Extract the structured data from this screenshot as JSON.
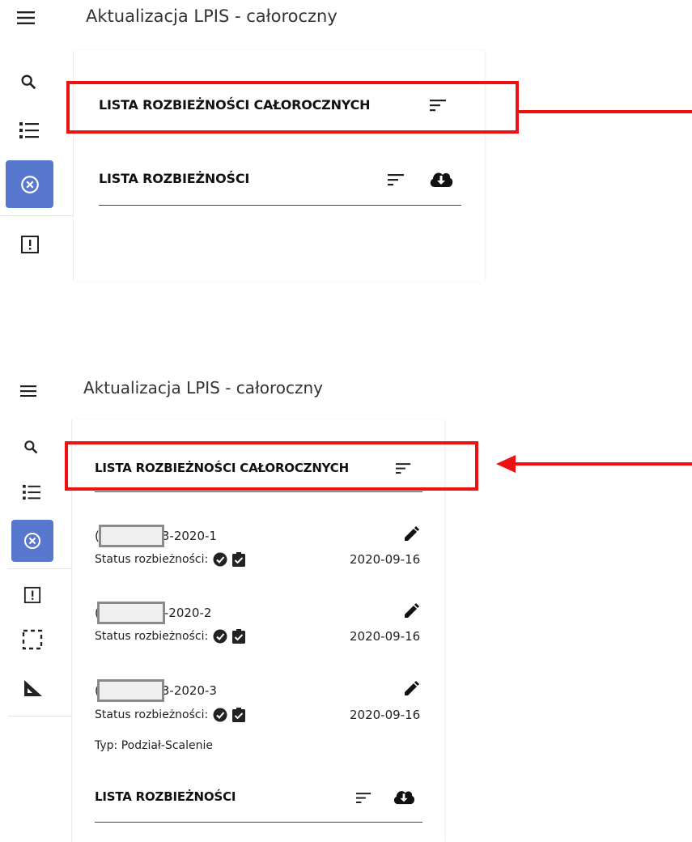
{
  "top": {
    "title": "Aktualizacja LPIS - całoroczny",
    "section_annual": "LISTA ROZBIEŻNOŚCI CAŁOROCZNYCH",
    "section_list": "LISTA ROZBIEŻNOŚCI"
  },
  "bottom": {
    "title": "Aktualizacja LPIS - całoroczny",
    "section_annual": "LISTA ROZBIEŻNOŚCI CAŁOROCZNYCH",
    "section_list": "LISTA ROZBIEŻNOŚCI",
    "items": [
      {
        "id_prefix": "(",
        "id_suffix": "3-2020-1",
        "status_label": "Status rozbieżności:",
        "date": "2020-09-16"
      },
      {
        "id_prefix": "(",
        "id_suffix": "-2020-2",
        "status_label": "Status rozbieżności:",
        "date": "2020-09-16"
      },
      {
        "id_prefix": "(",
        "id_suffix": "3-2020-3",
        "status_label": "Status rozbieżności:",
        "date": "2020-09-16"
      }
    ],
    "type_label": "Typ: Podział-Scalenie"
  },
  "colors": {
    "accent_active": "#5878d0",
    "annotation_red": "#ee1111"
  },
  "icons": {
    "menu": "hamburger-menu-icon",
    "search": "search-icon",
    "list": "list-icon",
    "discrepancy": "cancel-circle-icon",
    "alert": "alert-box-icon",
    "select": "dashed-select-icon",
    "measure": "set-square-icon",
    "sort": "sort-icon",
    "download": "cloud-download-icon",
    "edit": "pencil-icon",
    "status_ok": "check-circle-icon",
    "status_clip": "clipboard-check-icon"
  }
}
